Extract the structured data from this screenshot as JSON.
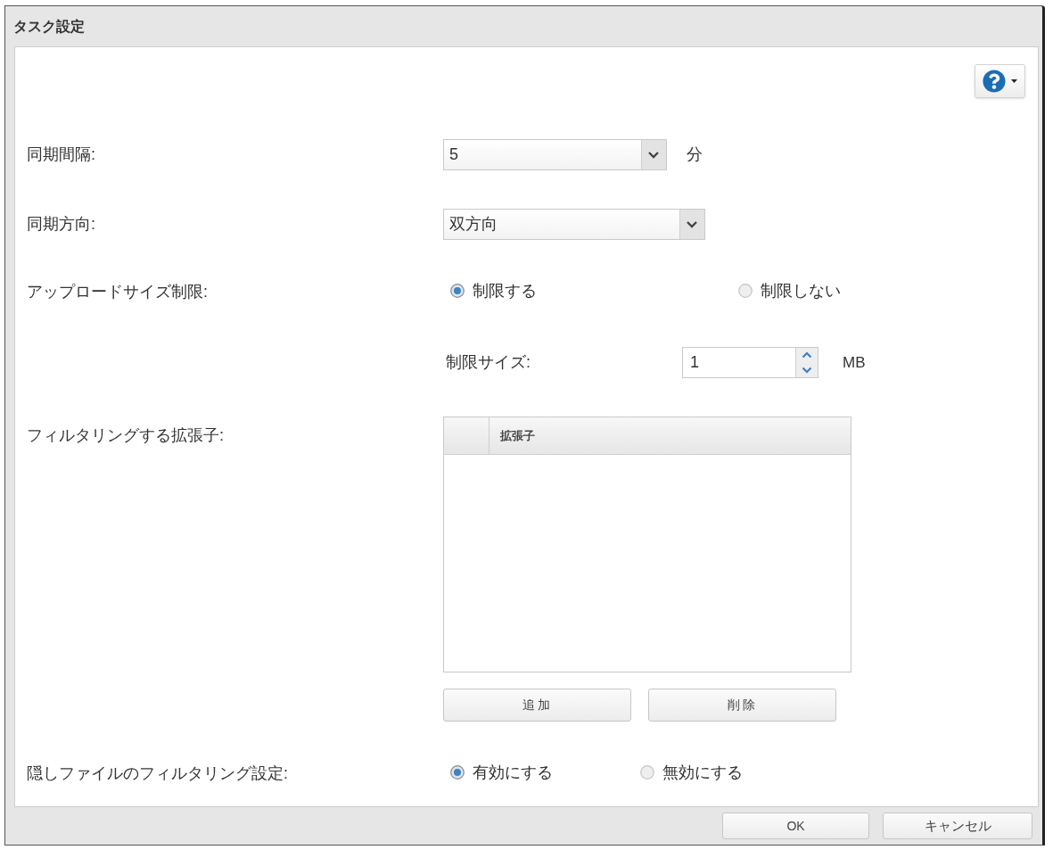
{
  "window": {
    "title": "タスク設定"
  },
  "sync_interval": {
    "label": "同期間隔:",
    "value": "5",
    "unit": "分"
  },
  "sync_direction": {
    "label": "同期方向:",
    "value": "双方向"
  },
  "upload_size_limit": {
    "label": "アップロードサイズ制限:",
    "options": [
      {
        "label": "制限する",
        "selected": true
      },
      {
        "label": "制限しない",
        "selected": false
      }
    ]
  },
  "limit_size": {
    "label": "制限サイズ:",
    "value": "1",
    "unit": "MB"
  },
  "filter_extensions": {
    "label": "フィルタリングする拡張子:",
    "table": {
      "columns": [
        "拡張子"
      ]
    },
    "buttons": [
      "追加",
      "削除"
    ]
  },
  "hidden_file_filtering": {
    "label": "隠しファイルのフィルタリング設定:",
    "options": [
      {
        "label": "有効にする",
        "selected": true
      },
      {
        "label": "無効にする",
        "selected": false
      }
    ]
  },
  "buttons": [
    "OK",
    "キャンセル"
  ]
}
